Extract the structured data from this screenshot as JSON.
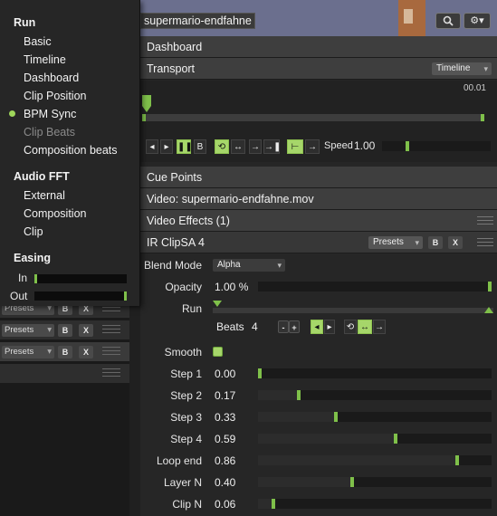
{
  "header": {
    "composition_name": "supermario-endfahne",
    "search_icon": "search-icon",
    "gear_icon": "gear-icon"
  },
  "menu": {
    "run_heading": "Run",
    "run_items": [
      {
        "label": "Basic",
        "selected": false,
        "disabled": false
      },
      {
        "label": "Timeline",
        "selected": false,
        "disabled": false
      },
      {
        "label": "Dashboard",
        "selected": false,
        "disabled": false
      },
      {
        "label": "Clip Position",
        "selected": false,
        "disabled": false
      },
      {
        "label": "BPM Sync",
        "selected": true,
        "disabled": false
      },
      {
        "label": "Clip Beats",
        "selected": false,
        "disabled": true
      },
      {
        "label": "Composition beats",
        "selected": false,
        "disabled": false
      }
    ],
    "fft_heading": "Audio FFT",
    "fft_items": [
      "External",
      "Composition",
      "Clip"
    ],
    "easing_heading": "Easing",
    "easing_in_label": "In",
    "easing_out_label": "Out",
    "easing_in_value": 0.0,
    "easing_out_value": 1.0
  },
  "left_rows": [
    {
      "presets": "Presets",
      "b": "B",
      "x": "X"
    },
    {
      "presets": "Presets",
      "b": "B",
      "x": "X"
    },
    {
      "presets": "Presets",
      "b": "B",
      "x": "X"
    }
  ],
  "dashboard": {
    "title": "Dashboard",
    "transport_label": "Transport",
    "transport_mode": "Timeline",
    "time": "00.01",
    "speed_label": "Speed",
    "speed_value": "1.00",
    "cue_points_label": "Cue Points",
    "video_label": "Video: supermario-endfahne.mov",
    "video_effects_label": "Video Effects (1)",
    "effect_name": "IR ClipSA 4",
    "effect_presets": "Presets",
    "effect_b": "B",
    "effect_x": "X",
    "blend_mode_label": "Blend Mode",
    "blend_mode_value": "Alpha",
    "opacity_label": "Opacity",
    "opacity_value": "1.00 %",
    "opacity_level": 1.0,
    "run_label": "Run",
    "beats_label": "Beats",
    "beats_value": "4",
    "beats_minus": "-",
    "beats_plus": "+",
    "smooth_label": "Smooth",
    "smooth_checked": true,
    "params": [
      {
        "label": "Step 1",
        "value": "0.00",
        "level": 0.0
      },
      {
        "label": "Step 2",
        "value": "0.17",
        "level": 0.17
      },
      {
        "label": "Step 3",
        "value": "0.33",
        "level": 0.33
      },
      {
        "label": "Step 4",
        "value": "0.59",
        "level": 0.59
      },
      {
        "label": "Loop end",
        "value": "0.86",
        "level": 0.86
      },
      {
        "label": "Layer N",
        "value": "0.40",
        "level": 0.4
      },
      {
        "label": "Clip N",
        "value": "0.06",
        "level": 0.06
      }
    ],
    "transport_buttons": [
      "◂",
      "▸",
      "❚❚",
      "B",
      "⟲",
      "↔",
      "→",
      "→❚",
      "⊢",
      "→"
    ],
    "accent_color": "#a6d66a"
  }
}
